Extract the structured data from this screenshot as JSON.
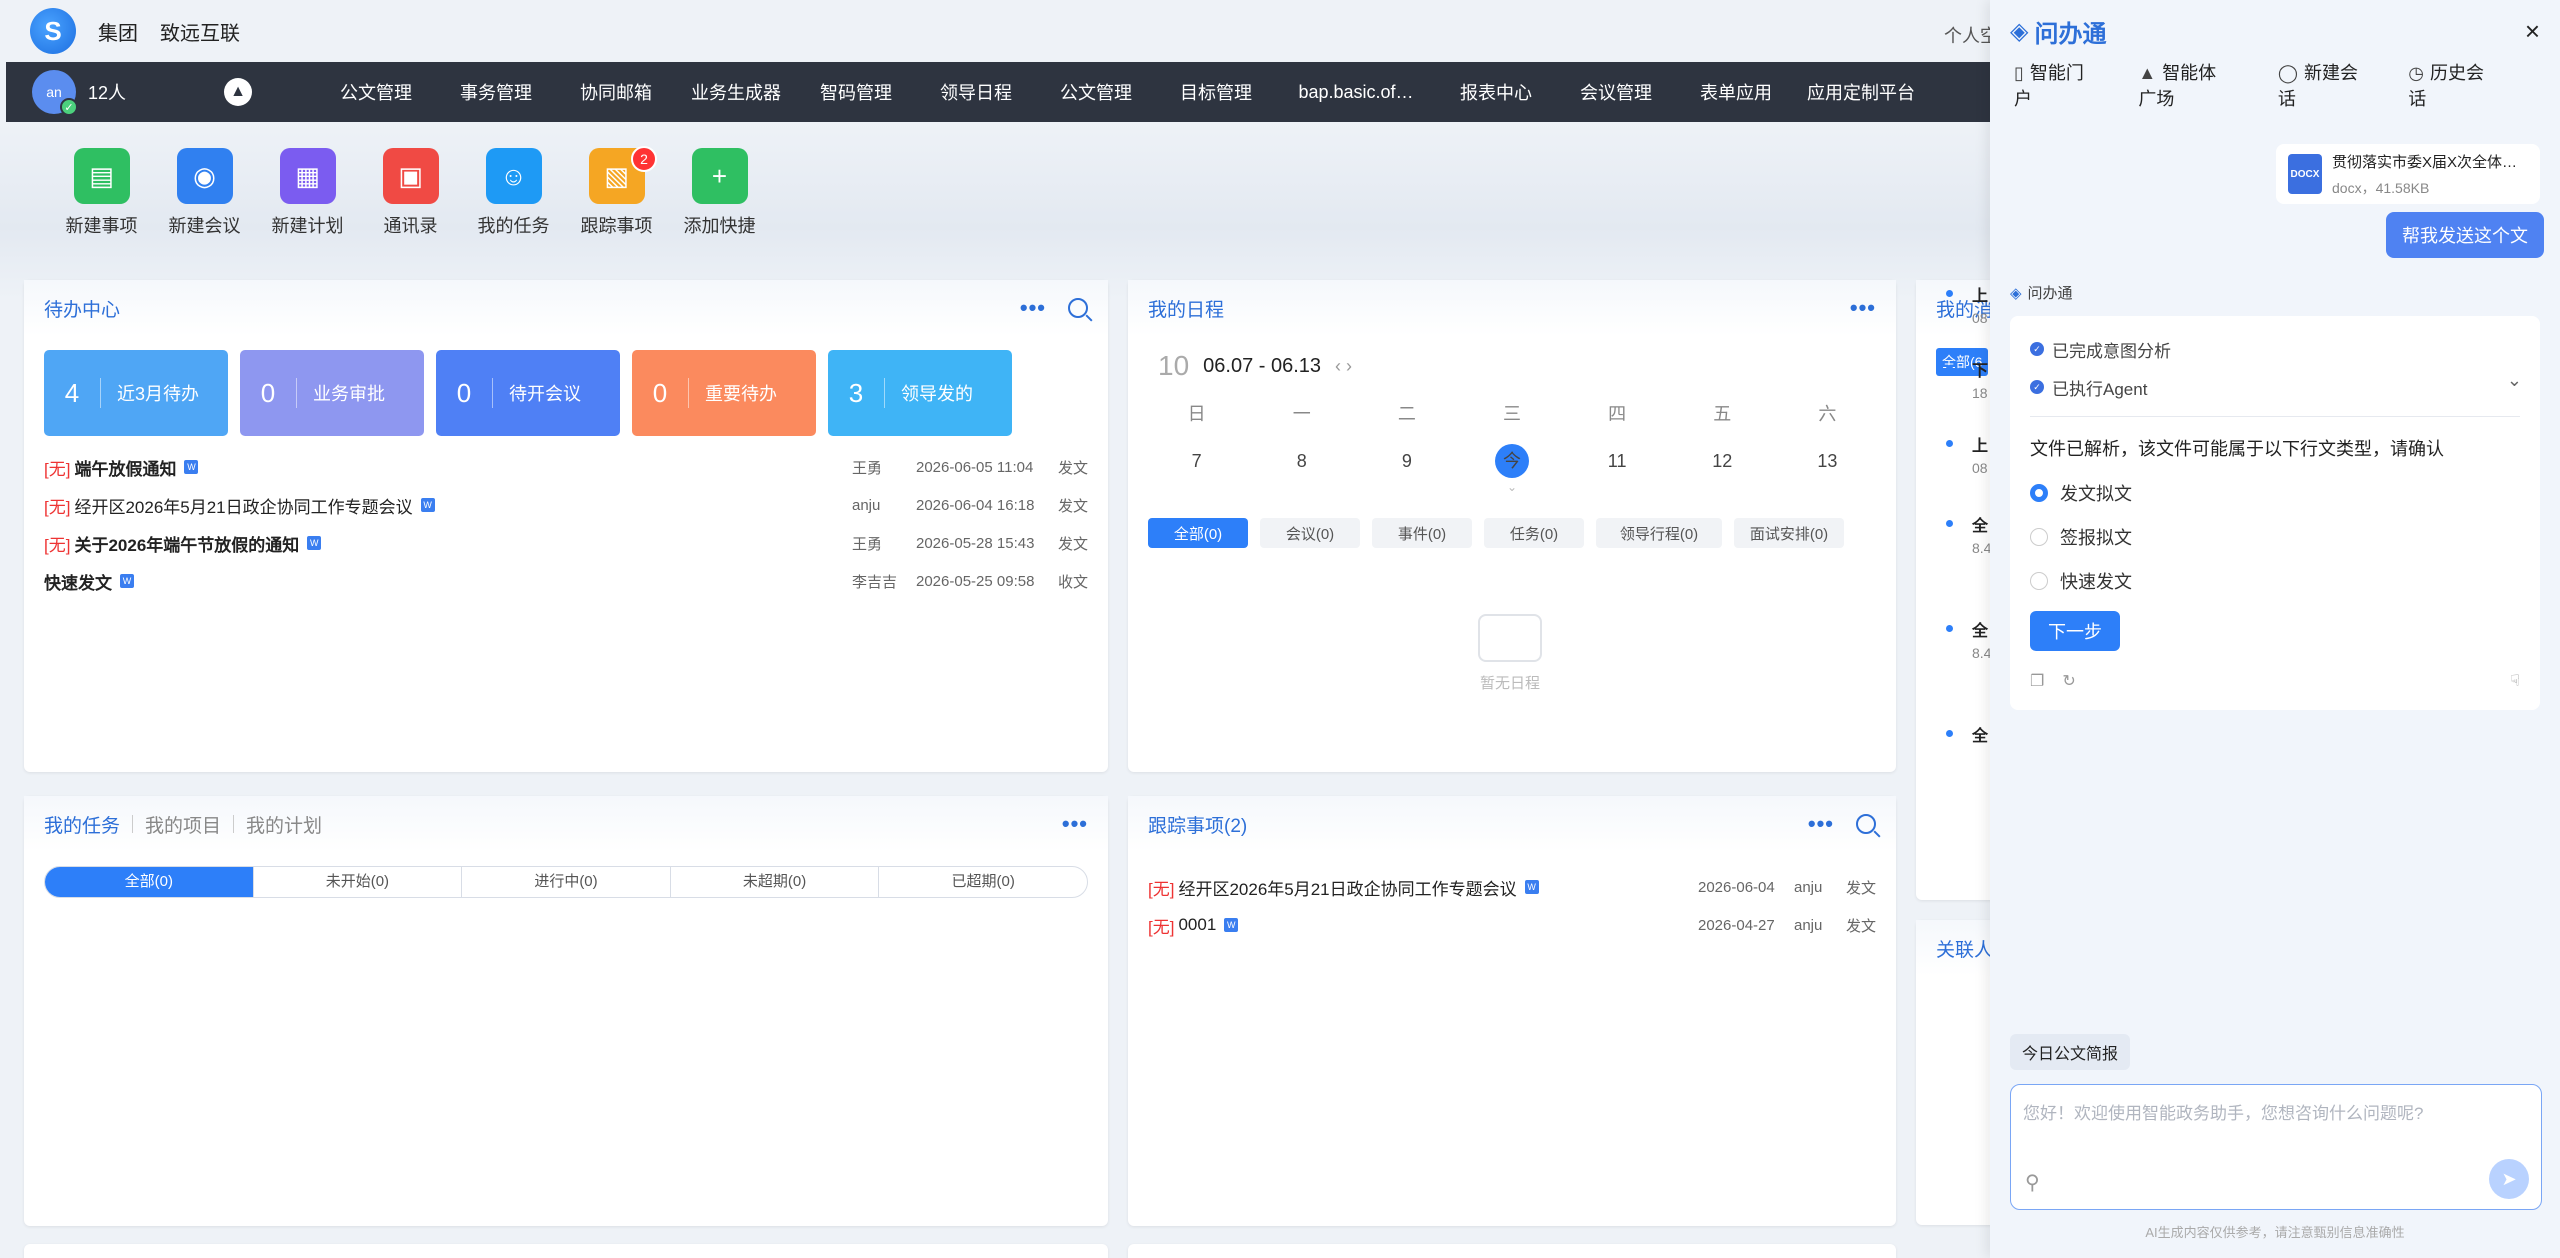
{
  "top": {
    "brand1": "集团",
    "brand2": "致远互联",
    "personal": "个人空"
  },
  "nav": {
    "avatar": "an",
    "count": "12人",
    "items": [
      "公文管理",
      "事务管理",
      "协同邮箱",
      "业务生成器",
      "智码管理",
      "领导日程",
      "公文管理",
      "目标管理",
      "bap.basic.of…",
      "报表中心",
      "会议管理",
      "表单应用",
      "应用定制平台"
    ]
  },
  "quick": [
    {
      "label": "新建事项",
      "icon": "new-item-icon",
      "color": "#2fbf62"
    },
    {
      "label": "新建会议",
      "icon": "meeting-icon",
      "color": "#3080f0"
    },
    {
      "label": "新建计划",
      "icon": "plan-icon",
      "color": "#7b5cf0"
    },
    {
      "label": "通讯录",
      "icon": "contacts-icon",
      "color": "#f04a44"
    },
    {
      "label": "我的任务",
      "icon": "task-icon",
      "color": "#1e9af5"
    },
    {
      "label": "跟踪事项",
      "icon": "track-icon",
      "color": "#f5a623",
      "badge": "2"
    },
    {
      "label": "添加快捷",
      "icon": "plus-icon",
      "color": "#2fbf62"
    }
  ],
  "todo": {
    "title": "待办中心",
    "cards": [
      {
        "num": "4",
        "label": "近3月待办",
        "color": "#4fa6f5"
      },
      {
        "num": "0",
        "label": "业务审批",
        "color": "#8e97f0"
      },
      {
        "num": "0",
        "label": "待开会议",
        "color": "#4f80f5"
      },
      {
        "num": "0",
        "label": "重要待办",
        "color": "#fb8a5e"
      },
      {
        "num": "3",
        "label": "领导发的",
        "color": "#3fb4f6"
      }
    ],
    "rows": [
      {
        "tag": "[无]",
        "title": "端午放假通知",
        "bold": true,
        "who": "王勇",
        "when": "2026-06-05 11:04",
        "kind": "发文"
      },
      {
        "tag": "[无]",
        "title": "经开区2026年5月21日政企协同工作专题会议",
        "bold": false,
        "who": "anju",
        "when": "2026-06-04 16:18",
        "kind": "发文"
      },
      {
        "tag": "[无]",
        "title": "关于2026年端午节放假的通知",
        "bold": true,
        "who": "王勇",
        "when": "2026-05-28 15:43",
        "kind": "发文"
      },
      {
        "tag": "",
        "title": "快速发文",
        "bold": true,
        "who": "李吉吉",
        "when": "2026-05-25 09:58",
        "kind": "收文"
      }
    ]
  },
  "schedule": {
    "title": "我的日程",
    "month": "10",
    "range": "06.07 - 06.13",
    "weekdays": [
      "日",
      "一",
      "二",
      "三",
      "四",
      "五",
      "六"
    ],
    "days": [
      "7",
      "8",
      "9",
      "今",
      "11",
      "12",
      "13"
    ],
    "filters": [
      "全部(0)",
      "会议(0)",
      "事件(0)",
      "任务(0)",
      "领导行程(0)",
      "面试安排(0)"
    ],
    "empty": "暂无日程"
  },
  "messages": {
    "title": "我的消",
    "tab": "全部(6",
    "items": [
      "上",
      "下",
      "上",
      "全",
      "全",
      "全"
    ],
    "subs": [
      "08",
      "18",
      "08",
      "8.4",
      "8.4",
      ""
    ]
  },
  "related": {
    "title": "关联人"
  },
  "tasks": {
    "tabs": [
      "我的任务",
      "我的项目",
      "我的计划"
    ],
    "filters": [
      "全部(0)",
      "未开始(0)",
      "进行中(0)",
      "未超期(0)",
      "已超期(0)"
    ]
  },
  "track": {
    "title": "跟踪事项(2)",
    "rows": [
      {
        "tag": "[无]",
        "title": "经开区2026年5月21日政企协同工作专题会议",
        "when": "2026-06-04",
        "who": "anju",
        "kind": "发文"
      },
      {
        "tag": "[无]",
        "title": "0001",
        "when": "2026-04-27",
        "who": "anju",
        "kind": "发文"
      }
    ]
  },
  "assistant": {
    "name": "问办通",
    "tabs": [
      "智能门户",
      "智能体广场",
      "新建会话",
      "历史会话"
    ],
    "file": {
      "name": "贯彻落实市委X届X次全体…",
      "size": "docx，41.58KB",
      "type": "DOCX"
    },
    "user_msg": "帮我发送这个文",
    "bot_name": "问办通",
    "steps": [
      "已完成意图分析",
      "已执行Agent"
    ],
    "question": "文件已解析，该文件可能属于以下行文类型，请确认",
    "options": [
      "发文拟文",
      "签报拟文",
      "快速发文"
    ],
    "selected": 0,
    "next": "下一步",
    "brief": "今日公文简报",
    "placeholder": "您好！欢迎使用智能政务助手，您想咨询什么问题呢?",
    "disclaimer": "AI生成内容仅供参考，请注意甄别信息准确性"
  }
}
